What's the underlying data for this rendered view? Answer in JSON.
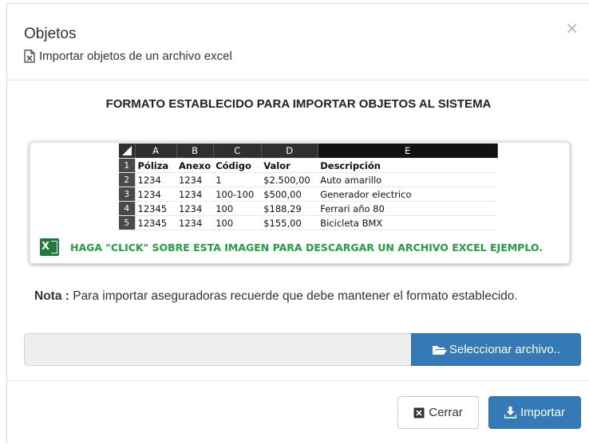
{
  "header": {
    "title": "Objetos",
    "subtitle": "Importar objetos de un archivo excel",
    "close_label": "×",
    "subtitle_icon": "file-excel-icon"
  },
  "body": {
    "format_title": "FORMATO ESTABLECIDO PARA IMPORTAR OBJETOS AL SISTEMA",
    "sheet": {
      "columns": [
        "A",
        "B",
        "C",
        "D",
        "E"
      ],
      "rows": [
        {
          "n": "1",
          "cells": [
            "Póliza",
            "Anexo",
            "Código",
            "Valor",
            "Descripción"
          ]
        },
        {
          "n": "2",
          "cells": [
            "1234",
            "1234",
            "1",
            "$2.500,00",
            "Auto amarillo"
          ]
        },
        {
          "n": "3",
          "cells": [
            "1234",
            "1234",
            "100-100",
            "$500,00",
            "Generador electrico"
          ]
        },
        {
          "n": "4",
          "cells": [
            "12345",
            "1234",
            "100",
            "$188,29",
            "Ferrari año 80"
          ]
        },
        {
          "n": "5",
          "cells": [
            "12345",
            "1234",
            "100",
            "$155,00",
            "Bicicleta BMX"
          ]
        }
      ]
    },
    "download_cta": "HAGA \"CLICK\" SOBRE ESTA IMAGEN PARA DESCARGAR UN ARCHIVO EXCEL EJEMPLO.",
    "download_icon": "excel-icon",
    "note_label": "Nota :",
    "note_text": " Para importar aseguradoras recuerde que debe mantener el formato establecido.",
    "file_value": "",
    "select_button": "Seleccionar archivo..",
    "select_icon": "folder-open-icon"
  },
  "footer": {
    "close_button": "Cerrar",
    "close_icon": "close-square-icon",
    "import_button": "Importar",
    "import_icon": "download-icon"
  },
  "colors": {
    "primary": "#337ab7",
    "excel_green": "#22a040",
    "excel_dark": "#1f7a3a"
  }
}
